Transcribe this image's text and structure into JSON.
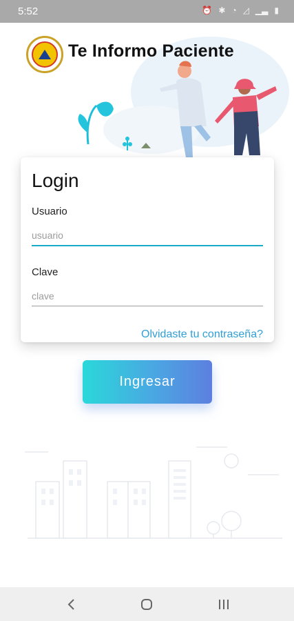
{
  "status_bar": {
    "time": "5:52",
    "icons": [
      "alarm-icon",
      "bluetooth-icon",
      "wifi-icon",
      "signal-icon",
      "signal-bars-icon",
      "battery-icon"
    ]
  },
  "header": {
    "app_title": "Te Informo Paciente",
    "logo_icon": "regional-health-seal-icon"
  },
  "login": {
    "title": "Login",
    "username_label": "Usuario",
    "username_placeholder": "usuario",
    "username_value": "",
    "password_label": "Clave",
    "password_placeholder": "clave",
    "password_value": "",
    "forgot_link": "Olvidaste tu contraseña?"
  },
  "actions": {
    "submit_label": "Ingresar"
  },
  "colors": {
    "accent_underline": "#1aa9c6",
    "link": "#2f9fd6",
    "button_gradient_start": "#2ad8da",
    "button_gradient_end": "#5d7fe0",
    "status_bar": "#a9a9a9"
  },
  "nav_bar": {
    "icons": [
      "back-icon",
      "home-icon",
      "recents-icon"
    ]
  }
}
